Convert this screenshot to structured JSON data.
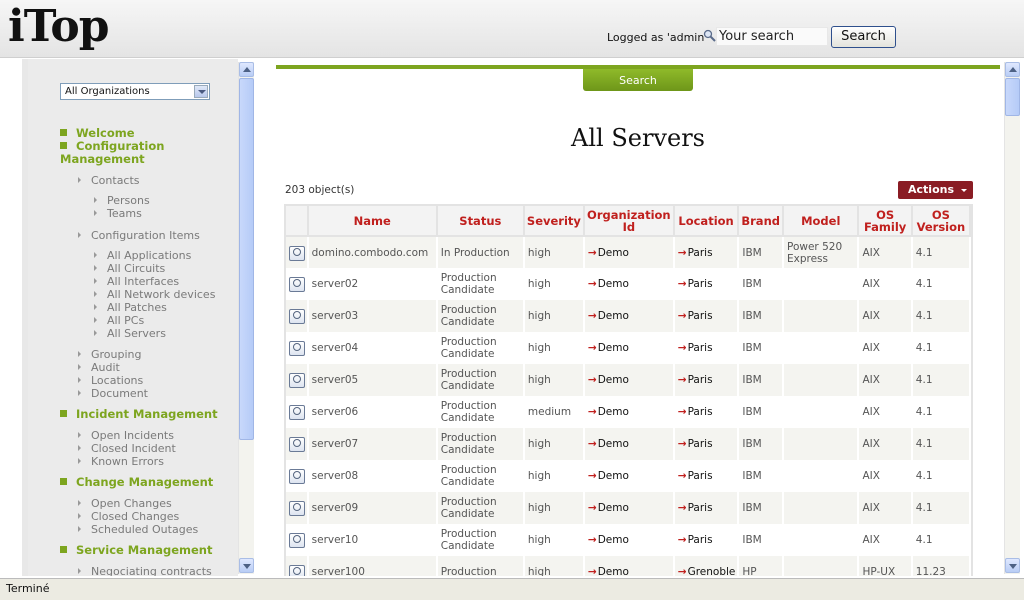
{
  "header": {
    "logo": "iTop",
    "logged_as": "Logged as 'admin'",
    "search_value": "Your search",
    "search_button": "Search"
  },
  "sidebar": {
    "org_select": "All Organizations",
    "items": [
      {
        "level": 1,
        "label": "Welcome"
      },
      {
        "level": 1,
        "label": "Configuration Management"
      },
      {
        "level": 2,
        "label": "Contacts"
      },
      {
        "level": 3,
        "label": "Persons"
      },
      {
        "level": 3,
        "label": "Teams"
      },
      {
        "level": 2,
        "label": "Configuration Items"
      },
      {
        "level": 3,
        "label": "All Applications"
      },
      {
        "level": 3,
        "label": "All Circuits"
      },
      {
        "level": 3,
        "label": "All Interfaces"
      },
      {
        "level": 3,
        "label": "All Network devices"
      },
      {
        "level": 3,
        "label": "All Patches"
      },
      {
        "level": 3,
        "label": "All PCs"
      },
      {
        "level": 3,
        "label": "All Servers"
      },
      {
        "level": 2,
        "label": "Grouping"
      },
      {
        "level": 2,
        "label": "Audit"
      },
      {
        "level": 2,
        "label": "Locations"
      },
      {
        "level": 2,
        "label": "Document"
      },
      {
        "level": 1,
        "label": "Incident Management"
      },
      {
        "level": 2,
        "label": "Open Incidents"
      },
      {
        "level": 2,
        "label": "Closed Incident"
      },
      {
        "level": 2,
        "label": "Known Errors"
      },
      {
        "level": 1,
        "label": "Change Management"
      },
      {
        "level": 2,
        "label": "Open Changes"
      },
      {
        "level": 2,
        "label": "Closed Changes"
      },
      {
        "level": 2,
        "label": "Scheduled Outages"
      },
      {
        "level": 1,
        "label": "Service Management"
      },
      {
        "level": 2,
        "label": "Negociating contracts"
      }
    ]
  },
  "main": {
    "search_tab": "Search",
    "title": "All Servers",
    "count": "203 object(s)",
    "actions": "Actions",
    "columns": [
      "Name",
      "Status",
      "Severity",
      "Organization Id",
      "Location",
      "Brand",
      "Model",
      "OS Family",
      "OS Version"
    ],
    "rows": [
      [
        "domino.combodo.com",
        "In Production",
        "high",
        "Demo",
        "Paris",
        "IBM",
        "Power 520 Express",
        "AIX",
        "4.1"
      ],
      [
        "server02",
        "Production Candidate",
        "high",
        "Demo",
        "Paris",
        "IBM",
        "",
        "AIX",
        "4.1"
      ],
      [
        "server03",
        "Production Candidate",
        "high",
        "Demo",
        "Paris",
        "IBM",
        "",
        "AIX",
        "4.1"
      ],
      [
        "server04",
        "Production Candidate",
        "high",
        "Demo",
        "Paris",
        "IBM",
        "",
        "AIX",
        "4.1"
      ],
      [
        "server05",
        "Production Candidate",
        "high",
        "Demo",
        "Paris",
        "IBM",
        "",
        "AIX",
        "4.1"
      ],
      [
        "server06",
        "Production Candidate",
        "medium",
        "Demo",
        "Paris",
        "IBM",
        "",
        "AIX",
        "4.1"
      ],
      [
        "server07",
        "Production Candidate",
        "high",
        "Demo",
        "Paris",
        "IBM",
        "",
        "AIX",
        "4.1"
      ],
      [
        "server08",
        "Production Candidate",
        "high",
        "Demo",
        "Paris",
        "IBM",
        "",
        "AIX",
        "4.1"
      ],
      [
        "server09",
        "Production Candidate",
        "high",
        "Demo",
        "Paris",
        "IBM",
        "",
        "AIX",
        "4.1"
      ],
      [
        "server10",
        "Production Candidate",
        "high",
        "Demo",
        "Paris",
        "IBM",
        "",
        "AIX",
        "4.1"
      ],
      [
        "server100",
        "Production",
        "high",
        "Demo",
        "Grenoble",
        "HP",
        "",
        "HP-UX",
        "11.23"
      ]
    ]
  },
  "statusbar": {
    "text": "Terminé"
  },
  "colors": {
    "accent": "#7da51f",
    "header_text": "#c0201e",
    "actions": "#8a1c24"
  }
}
